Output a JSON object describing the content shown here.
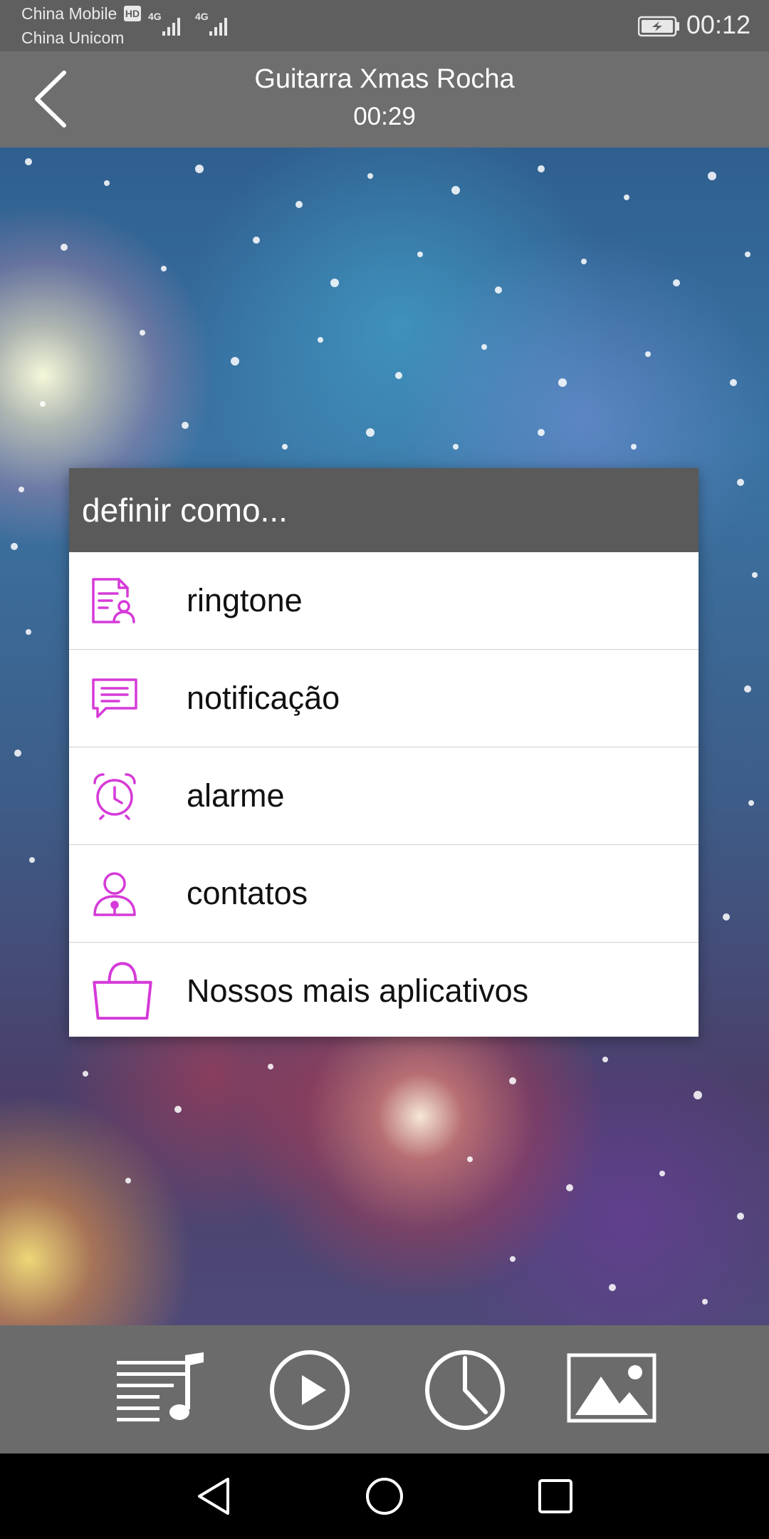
{
  "status_bar": {
    "carrier_1": "China Mobile",
    "hd_badge": "HD",
    "carrier_2": "China Unicom",
    "network_1": "4G",
    "network_2": "4G",
    "time": "00:12"
  },
  "header": {
    "title": "Guitarra Xmas Rocha",
    "duration": "00:29",
    "back_icon": "chevron-left-icon"
  },
  "dialog": {
    "title": "definir como...",
    "accent_color": "#d53ad8",
    "items": [
      {
        "label": "ringtone",
        "icon": "ringtone-contact-icon"
      },
      {
        "label": "notificação",
        "icon": "message-icon"
      },
      {
        "label": "alarme",
        "icon": "alarm-clock-icon"
      },
      {
        "label": "contatos",
        "icon": "contact-lock-icon"
      },
      {
        "label": "Nossos mais aplicativos",
        "icon": "shopping-bag-icon"
      }
    ]
  },
  "toolbar": {
    "buttons": [
      {
        "icon": "playlist-icon"
      },
      {
        "icon": "play-icon"
      },
      {
        "icon": "clock-icon"
      },
      {
        "icon": "image-icon"
      }
    ]
  },
  "nav_bar": {
    "buttons": [
      {
        "icon": "back-triangle-icon"
      },
      {
        "icon": "home-circle-icon"
      },
      {
        "icon": "recents-square-icon"
      }
    ]
  }
}
